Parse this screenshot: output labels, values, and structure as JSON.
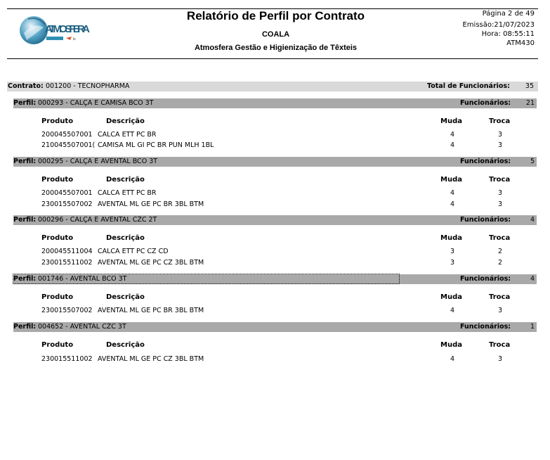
{
  "header": {
    "title": "Relatório de Perfil por Contrato",
    "subtitle": "COALA",
    "company": "Atmosfera Gestão e Higienização de Têxteis",
    "page": "Página 2 de 49",
    "emission": "Emissão:21/07/2023",
    "time": "Hora: 08:55:11",
    "report_code": "ATM430",
    "logo_text": "ATMOSFERA"
  },
  "contract": {
    "label": "Contrato:",
    "value": "001200 - TECNOPHARMA",
    "total_label": "Total de Funcionários:",
    "total_value": "35"
  },
  "columns": {
    "produto": "Produto",
    "descricao": "Descrição",
    "muda": "Muda",
    "troca": "Troca"
  },
  "profile_label": "Perfil:",
  "employees_label": "Funcionários:",
  "profiles": [
    {
      "code": "000293 - CALÇA E CAMISA BCO   3T",
      "employees": "21",
      "items": [
        {
          "produto": "200045507001",
          "descricao": "CALCA ETT PC BR",
          "muda": "4",
          "troca": "3"
        },
        {
          "produto": "210045507001(",
          "descricao": "CAMISA ML GI PC BR PUN MLH 1BL",
          "muda": "4",
          "troca": "3"
        }
      ]
    },
    {
      "code": "000295 - CALÇA E AVENTAL BCO   3T",
      "employees": "5",
      "items": [
        {
          "produto": "200045507001",
          "descricao": "CALCA ETT PC BR",
          "muda": "4",
          "troca": "3"
        },
        {
          "produto": "230015507002",
          "descricao": "AVENTAL ML GE PC BR 3BL BTM",
          "muda": "4",
          "troca": "3"
        }
      ]
    },
    {
      "code": "000296 - CALÇA E AVENTAL CZC   2T",
      "employees": "4",
      "items": [
        {
          "produto": "200045511004",
          "descricao": "CALCA ETT PC CZ CD",
          "muda": "3",
          "troca": "2"
        },
        {
          "produto": "230015511002",
          "descricao": "AVENTAL ML GE PC CZ 3BL BTM",
          "muda": "3",
          "troca": "2"
        }
      ]
    },
    {
      "code": "001746 - AVENTAL BCO   3T",
      "employees": "4",
      "items": [
        {
          "produto": "230015507002",
          "descricao": "AVENTAL ML GE PC BR 3BL BTM",
          "muda": "4",
          "troca": "3"
        }
      ]
    },
    {
      "code": "004652 - AVENTAL CZC   3T",
      "employees": "1",
      "items": [
        {
          "produto": "230015511002",
          "descricao": "AVENTAL ML GE PC CZ 3BL BTM",
          "muda": "4",
          "troca": "3"
        }
      ]
    }
  ]
}
